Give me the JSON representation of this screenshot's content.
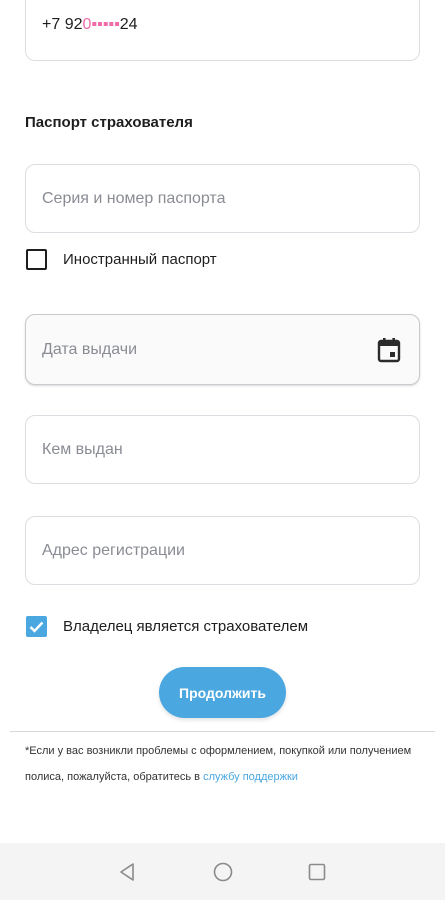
{
  "phone": {
    "prefix": "+7 92",
    "masked": "0▪▪▪▪▪",
    "suffix": "24"
  },
  "passport_section": {
    "title": "Паспорт страхователя",
    "series_placeholder": "Серия и номер паспорта",
    "foreign_passport_label": "Иностранный паспорт",
    "foreign_passport_checked": false,
    "issue_date_placeholder": "Дата выдачи",
    "issued_by_placeholder": "Кем выдан",
    "registration_address_placeholder": "Адрес регистрации"
  },
  "owner_is_insurer": {
    "label": "Владелец является страхователем",
    "checked": true
  },
  "continue_button": {
    "label": "Продолжить"
  },
  "footnote": {
    "text": "*Если у вас возникли проблемы с оформлением, покупкой или получением полиса, пожалуйста, обратитесь в ",
    "link_text": "службу поддержки"
  },
  "colors": {
    "accent": "#4aa7e0",
    "text": "#1e1e1e",
    "placeholder": "#8a8c94",
    "border": "#dcdde2"
  },
  "icons": {
    "calendar": "calendar-icon",
    "back": "back-triangle-icon",
    "home": "home-circle-icon",
    "recents": "recents-square-icon"
  }
}
